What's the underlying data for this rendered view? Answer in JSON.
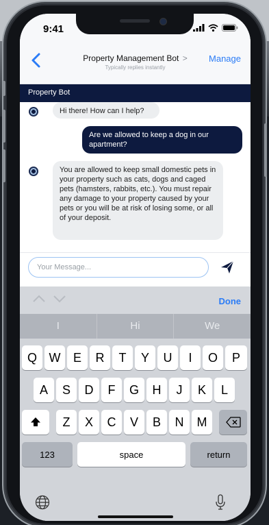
{
  "status": {
    "time": "9:41",
    "icons": [
      "signal-icon",
      "wifi-icon",
      "battery-icon"
    ]
  },
  "header": {
    "title": "Property Management Bot",
    "title_chevron": ">",
    "subtitle": "Typically replies instantly",
    "manage_label": "Manage",
    "back_icon": "chevron-left-icon"
  },
  "bot_bar": {
    "label": "Property Bot"
  },
  "messages": [
    {
      "sender": "bot",
      "text": "Hi there! How can I help?"
    },
    {
      "sender": "user",
      "text": "Are we allowed to keep a dog in our apartment?"
    },
    {
      "sender": "bot",
      "text": "You are allowed to keep small domestic pets in your property such as cats, dogs and caged pets (hamsters, rabbits, etc.). You must repair any damage to your property caused by your pets or you will be at risk of losing some, or all of your deposit."
    }
  ],
  "composer": {
    "placeholder": "Your Message...",
    "value": "",
    "send_icon": "send-icon"
  },
  "accessory": {
    "done_label": "Done",
    "prev_icon": "chevron-up-icon",
    "next_icon": "chevron-down-icon"
  },
  "keyboard": {
    "predictions": [
      "I",
      "Hi",
      "We"
    ],
    "row1": [
      "Q",
      "W",
      "E",
      "R",
      "T",
      "Y",
      "U",
      "I",
      "O",
      "P"
    ],
    "row2": [
      "A",
      "S",
      "D",
      "F",
      "G",
      "H",
      "J",
      "K",
      "L"
    ],
    "row3": [
      "Z",
      "X",
      "C",
      "V",
      "B",
      "N",
      "M"
    ],
    "numbers_label": "123",
    "space_label": "space",
    "return_label": "return",
    "shift_icon": "shift-icon",
    "delete_icon": "delete-icon",
    "globe_icon": "globe-icon",
    "mic_icon": "microphone-icon"
  },
  "colors": {
    "accent": "#2b7cf6",
    "brand_navy": "#0d1a3f"
  }
}
